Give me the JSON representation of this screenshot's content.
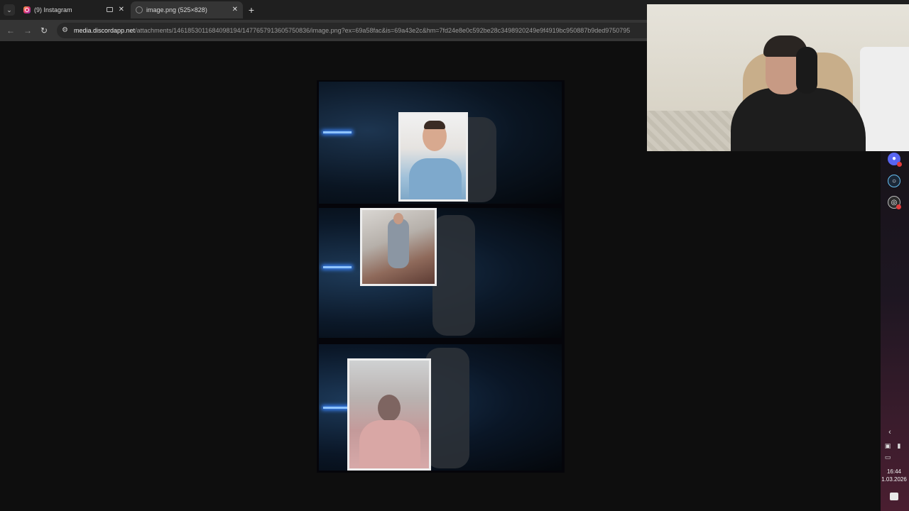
{
  "browser": {
    "tabs": [
      {
        "label": "(9) Instagram",
        "icon": "instagram-icon",
        "active": false
      },
      {
        "label": "image.png (525×828)",
        "icon": "image-icon",
        "active": true
      }
    ],
    "tab_close_glyph": "✕",
    "new_tab_glyph": "+",
    "tab_menu_glyph": "⌄",
    "address": {
      "host": "media.discordapp.net",
      "path": "/attachments/1461853011684098194/1477657913605750836/image.png?ex=69a58fac&is=69a43e2c&hm=7fd24e8e0c592be28c3498920249e9f4919bc950887b9ded9750795"
    }
  },
  "viewer": {
    "image_name": "image.png",
    "panels": [
      "panel-1",
      "panel-2",
      "panel-3"
    ]
  },
  "taskbar": {
    "apps": [
      "discord-icon",
      "steam-icon",
      "app-icon"
    ],
    "time": "16:44",
    "date": "1.03.2026"
  },
  "colors": {
    "browser_bg": "#1f1f1f",
    "toolbar_bg": "#353535",
    "page_bg": "#0e0e0e",
    "discord": "#5865f2"
  }
}
